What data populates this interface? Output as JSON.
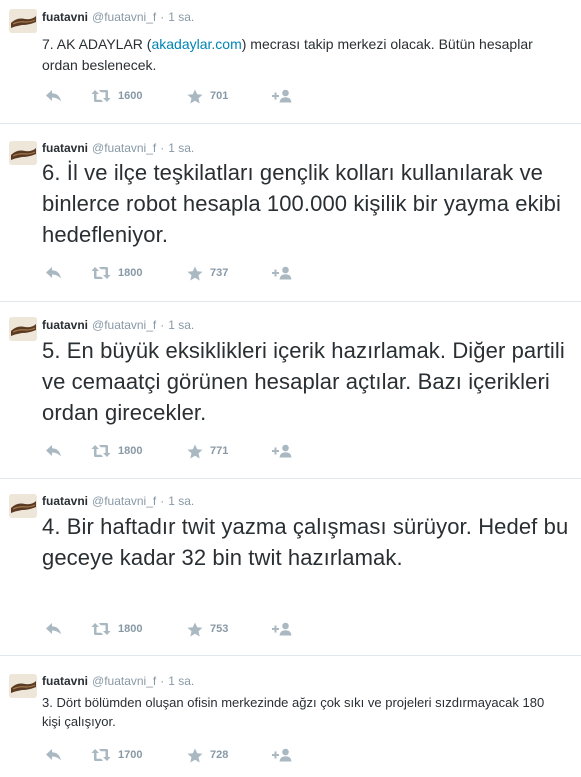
{
  "tweets": [
    {
      "name": "fuatavni",
      "handle": "@fuatavni_f",
      "dot": "·",
      "time": "1 sa.",
      "text_before": "7. AK ADAYLAR (",
      "link": "akadaylar.com",
      "text_after": ") mecrası takip merkezi olacak. Bütün hesaplar ordan beslenecek.",
      "retweets": "1600",
      "favorites": "701"
    },
    {
      "name": "fuatavni",
      "handle": "@fuatavni_f",
      "dot": "·",
      "time": "1 sa.",
      "text": "6. İl ve ilçe teşkilatları gençlik kolları kullanılarak ve binlerce robot hesapla 100.000 kişilik bir yayma ekibi hedefleniyor.",
      "retweets": "1800",
      "favorites": "737"
    },
    {
      "name": "fuatavni",
      "handle": "@fuatavni_f",
      "dot": "·",
      "time": "1 sa.",
      "text": "5. En büyük eksiklikleri içerik hazırlamak. Diğer partili ve cemaatçi görünen hesaplar açtılar. Bazı içerikleri ordan girecekler.",
      "retweets": "1800",
      "favorites": "771"
    },
    {
      "name": "fuatavni",
      "handle": "@fuatavni_f",
      "dot": "·",
      "time": "1 sa.",
      "text": "4. Bir haftadır twit yazma çalışması sürüyor. Hedef bu geceye kadar 32 bin twit hazırlamak.",
      "retweets": "1800",
      "favorites": "753"
    },
    {
      "name": "fuatavni",
      "handle": "@fuatavni_f",
      "dot": "·",
      "time": "1 sa.",
      "text": "3. Dört bölümden oluşan ofisin merkezinde ağzı çok sıkı ve projeleri sızdırmayacak 180 kişi çalışıyor.",
      "retweets": "1700",
      "favorites": "728"
    }
  ],
  "icons": {
    "reply": "reply-arrow-icon",
    "retweet": "retweet-icon",
    "favorite": "star-icon",
    "follow": "add-user-icon",
    "avatar": "avatar-image"
  },
  "colors": {
    "text": "#292f33",
    "muted": "#8899a6",
    "icon": "#aab8c2",
    "link": "#0084b4",
    "divider": "#e1e8ed"
  }
}
